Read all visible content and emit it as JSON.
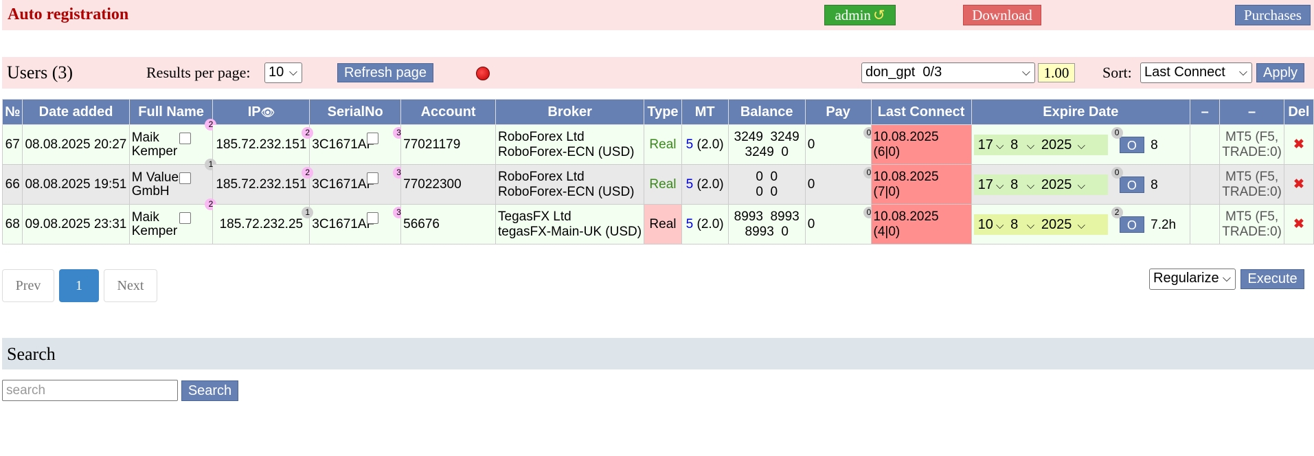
{
  "header": {
    "title": "Auto registration",
    "admin_label": "admin",
    "admin_icon": "refresh-icon",
    "download_label": "Download",
    "purchases_label": "Purchases"
  },
  "users_bar": {
    "title": "Users (3)",
    "results_label": "Results per page:",
    "results_value": "10",
    "refresh_label": "Refresh page",
    "account_select": "don_gpt  0/3",
    "multiplier": "1.00",
    "sort_label": "Sort:",
    "sort_value": "Last Connect",
    "apply_label": "Apply"
  },
  "table": {
    "headers": [
      "№",
      "Date added",
      "Full Name",
      "IP",
      "SerialNo",
      "Account",
      "Broker",
      "Type",
      "MT",
      "Balance",
      "Pay",
      "Last Connect",
      "Expire Date",
      "",
      "",
      "Del"
    ],
    "rows": [
      {
        "no": "67",
        "date": "08.08.2025 20:27",
        "name1": "Maik",
        "name2": "Kemper",
        "name_badge": "2",
        "ip": "185.72.232.151",
        "ip_badge": "2",
        "serial": "3C1671AF",
        "serial_badge": "3",
        "account": "77021179",
        "broker1": "RoboForex Ltd",
        "broker2": "RoboForex-ECN (USD)",
        "type": "Real",
        "mt": "5",
        "mt_ver": "(2.0)",
        "bal1": "3249  3249",
        "bal2": "3249  0",
        "pay": "0",
        "pay_badge": "0",
        "last_connect": "10.08.2025 (6|0)",
        "exp_day": "17",
        "exp_month": "8",
        "exp_year": "2025",
        "exp_badge": "0",
        "o": "O",
        "exp_extra": "8",
        "tiny": "MT5 (F5, TRADE:0)"
      },
      {
        "no": "66",
        "date": "08.08.2025 19:51",
        "name1": "M Values",
        "name2": "GmbH",
        "name_badge": "1",
        "ip": "185.72.232.151",
        "ip_badge": "2",
        "serial": "3C1671AF",
        "serial_badge": "3",
        "account": "77022300",
        "broker1": "RoboForex Ltd",
        "broker2": "RoboForex-ECN (USD)",
        "type": "Real",
        "mt": "5",
        "mt_ver": "(2.0)",
        "bal1": "0  0",
        "bal2": "0  0",
        "pay": "0",
        "pay_badge": "0",
        "last_connect": "10.08.2025 (7|0)",
        "exp_day": "17",
        "exp_month": "8",
        "exp_year": "2025",
        "exp_badge": "0",
        "o": "O",
        "exp_extra": "8",
        "tiny": "MT5 (F5, TRADE:0)"
      },
      {
        "no": "68",
        "date": "09.08.2025 23:31",
        "name1": "Maik",
        "name2": "Kemper",
        "name_badge": "2",
        "ip": "185.72.232.25",
        "ip_badge": "1",
        "serial": "3C1671AF",
        "serial_badge": "3",
        "account": "56676",
        "broker1": "TegasFX Ltd",
        "broker2": "tegasFX-Main-UK (USD)",
        "type": "Real",
        "mt": "5",
        "mt_ver": "(2.0)",
        "bal1": "8993  8993",
        "bal2": "8993  0",
        "pay": "0",
        "pay_badge": "0",
        "last_connect": "10.08.2025 (4|0)",
        "exp_day": "10",
        "exp_month": "8",
        "exp_year": "2025",
        "exp_badge": "2",
        "o": "O",
        "exp_extra": "7.2h",
        "tiny": "MT5 (F5, TRADE:0)"
      }
    ]
  },
  "pagination": {
    "prev": "Prev",
    "current": "1",
    "next": "Next"
  },
  "bulk": {
    "action_value": "Regularize",
    "execute_label": "Execute"
  },
  "search": {
    "title": "Search",
    "placeholder": "search",
    "button_label": "Search"
  },
  "colors": {
    "header_bg": "#fde4e4",
    "table_header": "#6680b3",
    "last_connect": "#ff8f8f",
    "active_page": "#3a86c8"
  }
}
